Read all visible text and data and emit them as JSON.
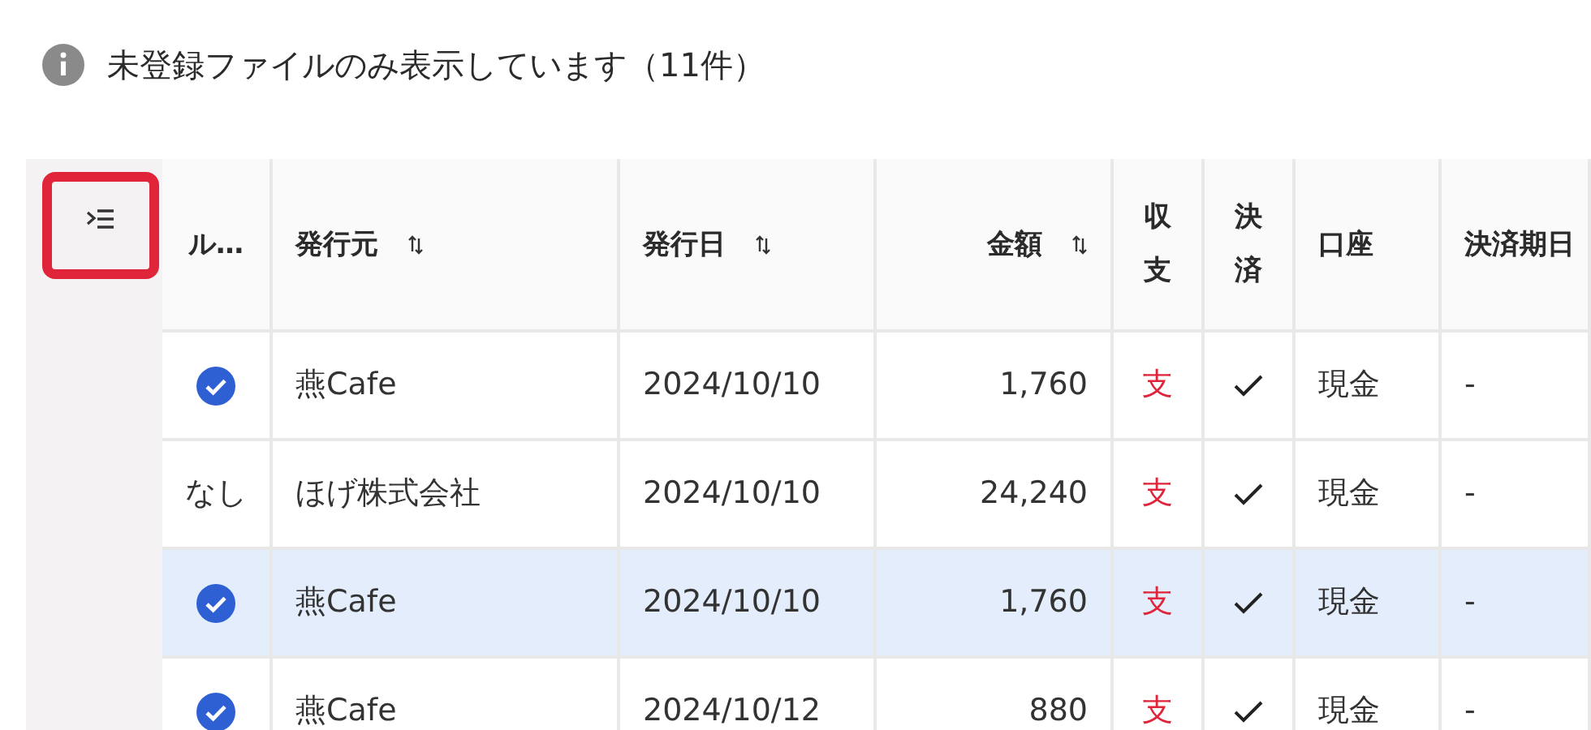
{
  "notice": {
    "text": "未登録ファイルのみ表示しています（11件）"
  },
  "columns_button": {
    "highlighted": true
  },
  "table": {
    "columns": [
      {
        "label": "ル…",
        "sortable": false
      },
      {
        "label": "発行元",
        "sortable": true
      },
      {
        "label": "発行日",
        "sortable": true
      },
      {
        "label": "金額",
        "sortable": true
      },
      {
        "label": "収支",
        "sortable": false
      },
      {
        "label": "決済",
        "sortable": false
      },
      {
        "label": "口座",
        "sortable": false
      },
      {
        "label": "決済期日",
        "sortable": false
      }
    ],
    "rows": [
      {
        "selected": false,
        "rule": {
          "kind": "check"
        },
        "issuer": "燕Cafe",
        "date": "2024/10/10",
        "amount": "1,760",
        "flow": "支",
        "settled": true,
        "account": "現金",
        "due": "-"
      },
      {
        "selected": false,
        "rule": {
          "kind": "text",
          "text": "なし"
        },
        "issuer": "ほげ株式会社",
        "date": "2024/10/10",
        "amount": "24,240",
        "flow": "支",
        "settled": true,
        "account": "現金",
        "due": "-"
      },
      {
        "selected": true,
        "rule": {
          "kind": "check"
        },
        "issuer": "燕Cafe",
        "date": "2024/10/10",
        "amount": "1,760",
        "flow": "支",
        "settled": true,
        "account": "現金",
        "due": "-"
      },
      {
        "selected": false,
        "rule": {
          "kind": "check"
        },
        "issuer": "燕Cafe",
        "date": "2024/10/12",
        "amount": "880",
        "flow": "支",
        "settled": true,
        "account": "現金",
        "due": "-"
      }
    ]
  }
}
